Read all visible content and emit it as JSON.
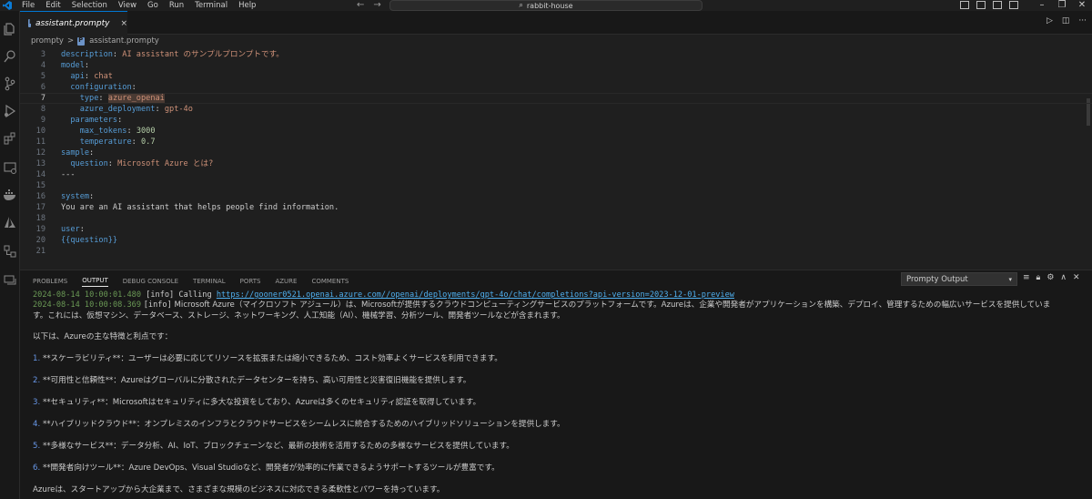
{
  "menu": [
    "File",
    "Edit",
    "Selection",
    "View",
    "Go",
    "Run",
    "Terminal",
    "Help"
  ],
  "search": {
    "label": "rabbit-house"
  },
  "tab": {
    "label": "assistant.prompty",
    "close": "×"
  },
  "breadcrumb": {
    "folder": "prompty",
    "sep": ">",
    "file": "assistant.prompty"
  },
  "colors": {
    "accent": "#0078d4",
    "key": "#569cd6",
    "string": "#ce9178",
    "number": "#b5cea8"
  },
  "editor": {
    "active_line": "7",
    "lines": [
      {
        "n": "3",
        "key": "description",
        "indent": "",
        "colon": ": ",
        "val": "AI assistant のサンプルプロンプトです。",
        "vt": "s"
      },
      {
        "n": "4",
        "key": "model",
        "indent": "",
        "colon": ":",
        "val": "",
        "vt": "s"
      },
      {
        "n": "5",
        "key": "api",
        "indent": "  ",
        "colon": ": ",
        "val": "chat",
        "vt": "s"
      },
      {
        "n": "6",
        "key": "configuration",
        "indent": "  ",
        "colon": ":",
        "val": "",
        "vt": "s"
      },
      {
        "n": "7",
        "key": "type",
        "indent": "    ",
        "colon": ": ",
        "val": "azure_openai",
        "vt": "s"
      },
      {
        "n": "8",
        "key": "azure_deployment",
        "indent": "    ",
        "colon": ": ",
        "val": "gpt-4o",
        "vt": "s"
      },
      {
        "n": "9",
        "key": "parameters",
        "indent": "  ",
        "colon": ":",
        "val": "",
        "vt": "s"
      },
      {
        "n": "10",
        "key": "max_tokens",
        "indent": "    ",
        "colon": ": ",
        "val": "3000",
        "vt": "n"
      },
      {
        "n": "11",
        "key": "temperature",
        "indent": "    ",
        "colon": ": ",
        "val": "0.7",
        "vt": "n"
      },
      {
        "n": "12",
        "key": "sample",
        "indent": "",
        "colon": ":",
        "val": "",
        "vt": "s"
      },
      {
        "n": "13",
        "key": "question",
        "indent": "  ",
        "colon": ": ",
        "val": "Microsoft Azure とは?",
        "vt": "s"
      },
      {
        "n": "14",
        "key": "",
        "indent": "",
        "colon": "",
        "val": "---",
        "vt": "p"
      },
      {
        "n": "15",
        "key": "",
        "indent": "",
        "colon": "",
        "val": "",
        "vt": "p"
      },
      {
        "n": "16",
        "key": "system",
        "indent": "",
        "colon": ":",
        "val": "",
        "vt": "s"
      },
      {
        "n": "17",
        "key": "",
        "indent": "",
        "colon": "",
        "val": "You are an AI assistant that helps people find information.",
        "vt": "p"
      },
      {
        "n": "18",
        "key": "",
        "indent": "",
        "colon": "",
        "val": "",
        "vt": "p"
      },
      {
        "n": "19",
        "key": "user",
        "indent": "",
        "colon": ":",
        "val": "",
        "vt": "s"
      },
      {
        "n": "20",
        "key": "",
        "indent": "",
        "colon": "",
        "val": "{{question}}",
        "vt": "k"
      },
      {
        "n": "21",
        "key": "",
        "indent": "",
        "colon": "",
        "val": "",
        "vt": "p"
      }
    ]
  },
  "panel": {
    "tabs": [
      "PROBLEMS",
      "OUTPUT",
      "DEBUG CONSOLE",
      "TERMINAL",
      "PORTS",
      "AZURE",
      "COMMENTS"
    ],
    "active_tab": "OUTPUT",
    "output_channel": "Prompty Output",
    "log1": {
      "time": "2024-08-14 10:00:01.480",
      "level": "[info]",
      "text": "Calling",
      "url": "https://gooner0521.openai.azure.com//openai/deployments/gpt-4o/chat/completions?api-version=2023-12-01-preview"
    },
    "log2": {
      "time": "2024-08-14 10:00:08.369",
      "level": "[info]",
      "text": "Microsoft Azure（マイクロソフト アジュール）は、Microsoftが提供するクラウドコンピューティングサービスのプラットフォームです。Azureは、企業や開発者がアプリケーションを構築、デプロイ、管理するための幅広いサービスを提供していま"
    },
    "wrap": "す。これには、仮想マシン、データベース、ストレージ、ネットワーキング、人工知能（AI）、機械学習、分析ツール、開発者ツールなどが含まれます。",
    "intro": "以下は、Azureの主な特徴と利点です：",
    "items": [
      {
        "num": "1.",
        "text": "**スケーラビリティ**：ユーザーは必要に応じてリソースを拡張または縮小できるため、コスト効率よくサービスを利用できます。"
      },
      {
        "num": "2.",
        "text": "**可用性と信頼性**：Azureはグローバルに分散されたデータセンターを持ち、高い可用性と災害復旧機能を提供します。"
      },
      {
        "num": "3.",
        "text": "**セキュリティ**：Microsoftはセキュリティに多大な投資をしており、Azureは多くのセキュリティ認証を取得しています。"
      },
      {
        "num": "4.",
        "text": "**ハイブリッドクラウド**：オンプレミスのインフラとクラウドサービスをシームレスに統合するためのハイブリッドソリューションを提供します。"
      },
      {
        "num": "5.",
        "text": "**多様なサービス**：データ分析、AI、IoT、ブロックチェーンなど、最新の技術を活用するための多様なサービスを提供しています。"
      },
      {
        "num": "6.",
        "text": "**開発者向けツール**：Azure DevOps、Visual Studioなど、開発者が効率的に作業できるようサポートするツールが豊富です。"
      }
    ],
    "outro": "Azureは、スタートアップから大企業まで、さまざまな規模のビジネスに対応できる柔軟性とパワーを持っています。"
  }
}
